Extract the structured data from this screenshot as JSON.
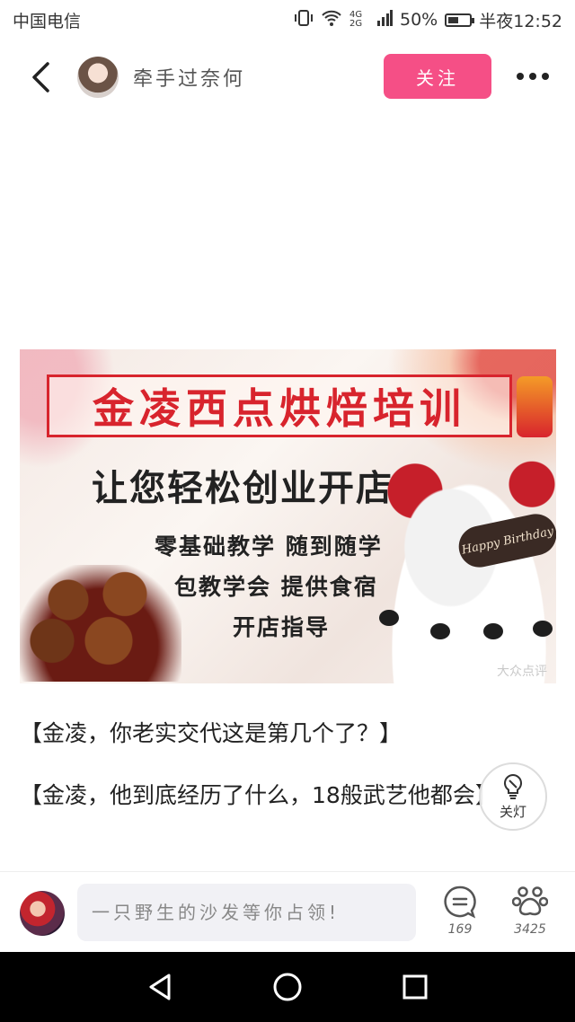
{
  "status_bar": {
    "carrier": "中国电信",
    "network": "4G 2G",
    "battery_percent": "50%",
    "battery_level": 0.5,
    "time": "半夜12:52"
  },
  "header": {
    "author_name": "牵手过奈何",
    "follow_label": "关注"
  },
  "banner": {
    "title": "金凌西点烘焙培训",
    "subtitle": "让您轻松创业开店",
    "lines": [
      "零基础教学  随到随学",
      "包教学会  提供食宿",
      "开店指导"
    ],
    "cake_plaque": "Happy Birthday",
    "watermark": "大众点评"
  },
  "post": {
    "paragraphs": [
      "【金凌，你老实交代这是第几个了？】",
      "【金凌，他到底经历了什么，18般武艺他都会】"
    ]
  },
  "light_toggle": {
    "label": "关灯"
  },
  "bottom_bar": {
    "comment_placeholder": "一只野生的沙发等你占领!",
    "comment_count": "169",
    "like_count": "3425"
  }
}
